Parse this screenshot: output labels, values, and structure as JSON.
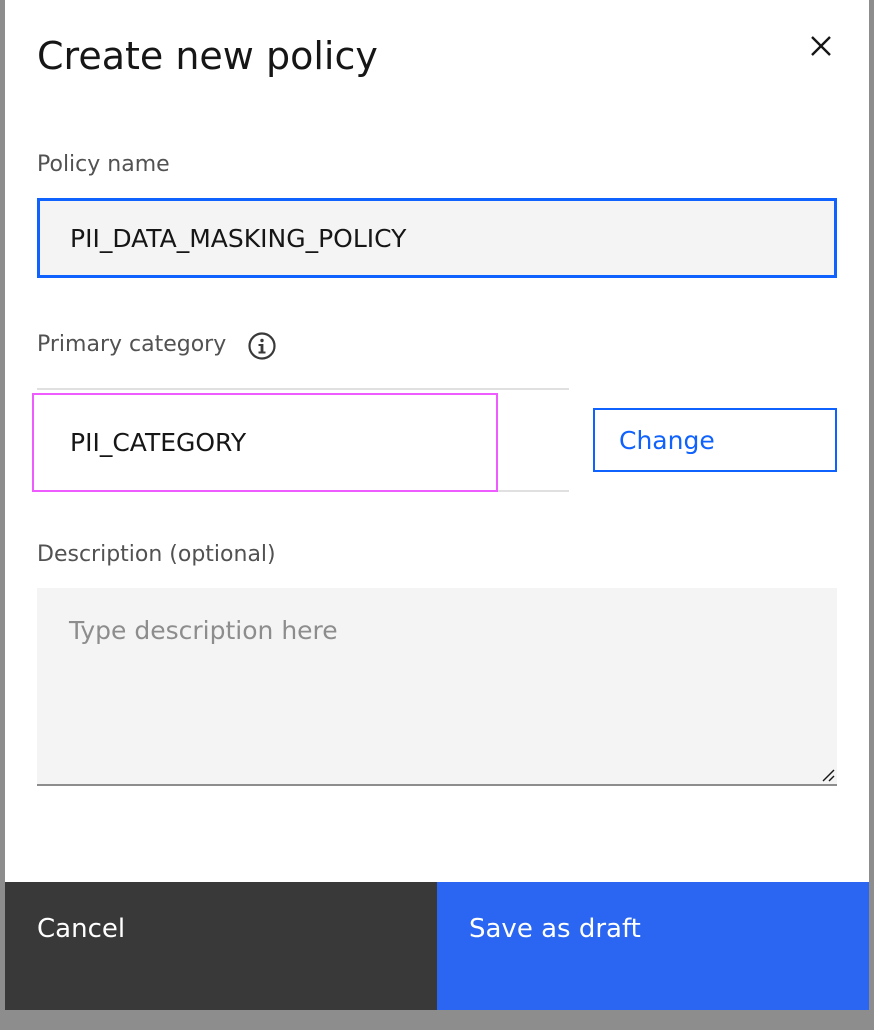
{
  "modal": {
    "title": "Create new policy",
    "close_icon": "close-icon"
  },
  "policy_name": {
    "label": "Policy name",
    "value": "PII_DATA_MASKING_POLICY"
  },
  "primary_category": {
    "label": "Primary category",
    "info_icon": "info-icon",
    "value": "PII_CATEGORY",
    "change_label": "Change"
  },
  "description": {
    "label": "Description (optional)",
    "placeholder": "Type description here",
    "value": ""
  },
  "footer": {
    "cancel_label": "Cancel",
    "save_label": "Save as draft"
  },
  "colors": {
    "primary": "#0f62fe",
    "save_button": "#2a66f1",
    "cancel_button": "#393939",
    "highlight": "#ee5bff",
    "field_background": "#f4f4f4"
  }
}
